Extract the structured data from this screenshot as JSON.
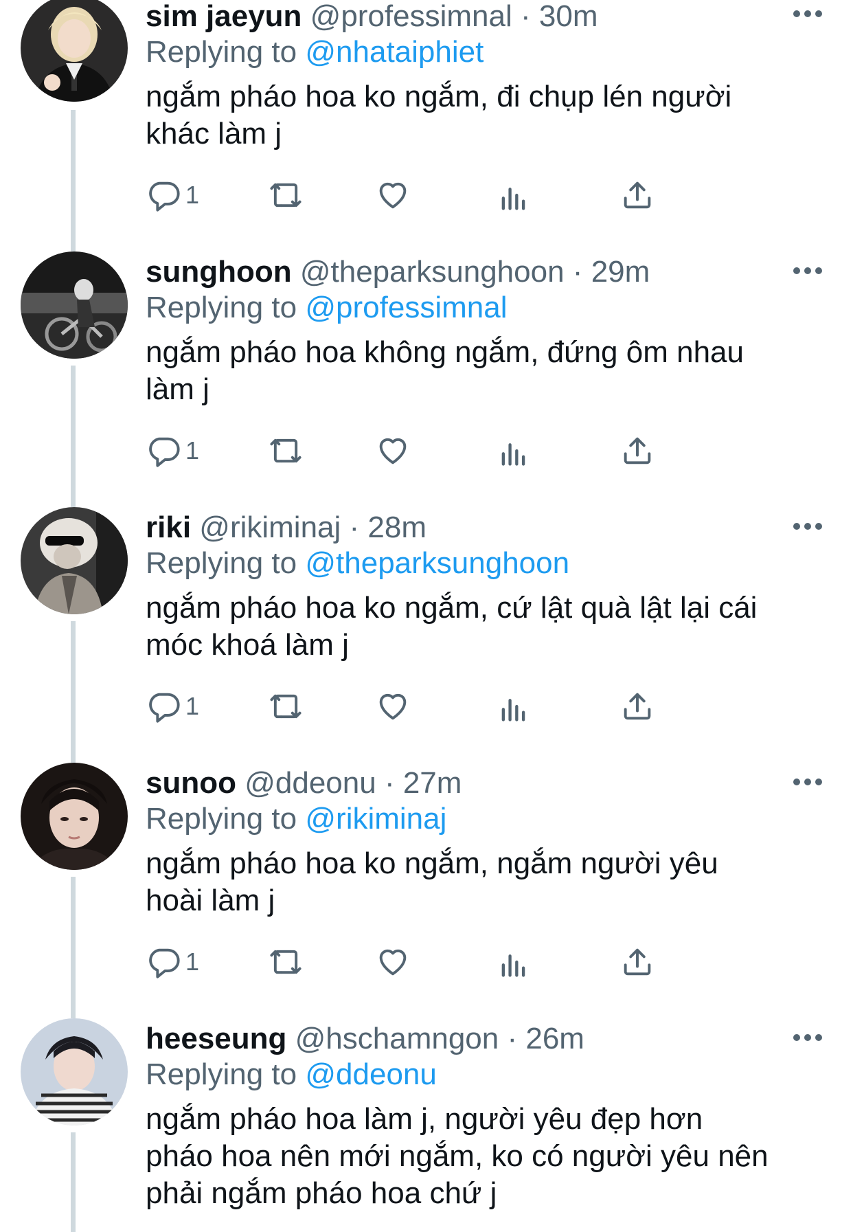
{
  "tweets": [
    {
      "display_name": "sim jaeyun",
      "handle": "@professimnal",
      "time": "30m",
      "replying_label": "Replying to",
      "replying_to": "@nhataiphiet",
      "text_line1": "ngắm pháo hoa ko ngắm, đi chụp lén người",
      "text_line2": "khác làm j",
      "text_line3": "",
      "reply_count": "1"
    },
    {
      "display_name": "sunghoon",
      "handle": "@theparksunghoon",
      "time": "29m",
      "replying_label": "Replying to",
      "replying_to": "@professimnal",
      "text_line1": "ngắm pháo hoa không ngắm, đứng ôm nhau",
      "text_line2": "làm j",
      "text_line3": "",
      "reply_count": "1"
    },
    {
      "display_name": "riki",
      "handle": "@rikiminaj",
      "time": "28m",
      "replying_label": "Replying to",
      "replying_to": "@theparksunghoon",
      "text_line1": "ngắm pháo hoa ko ngắm, cứ lật quà lật lại cái",
      "text_line2": "móc khoá làm j",
      "text_line3": "",
      "reply_count": "1"
    },
    {
      "display_name": "sunoo",
      "handle": "@ddeonu",
      "time": "27m",
      "replying_label": "Replying to",
      "replying_to": "@rikiminaj",
      "text_line1": "ngắm pháo hoa ko ngắm, ngắm người yêu",
      "text_line2": "hoài làm j",
      "text_line3": "",
      "reply_count": "1"
    },
    {
      "display_name": "heeseung",
      "handle": "@hschamngon",
      "time": "26m",
      "replying_label": "Replying to",
      "replying_to": "@ddeonu",
      "text_line1": "ngắm pháo hoa làm j, người yêu đẹp hơn",
      "text_line2": "pháo hoa nên mới ngắm, ko có người yêu nên",
      "text_line3": "phải ngắm pháo hoa chứ j",
      "reply_count": ""
    }
  ],
  "separator": " · ",
  "icons": {
    "reply": "reply-icon",
    "retweet": "retweet-icon",
    "like": "heart-icon",
    "analytics": "analytics-icon",
    "share": "share-icon",
    "more": "more-icon"
  },
  "colors": {
    "link": "#1d9bf0",
    "secondary": "#536471",
    "primary": "#0f1419",
    "thread_line": "#cfd9de"
  }
}
